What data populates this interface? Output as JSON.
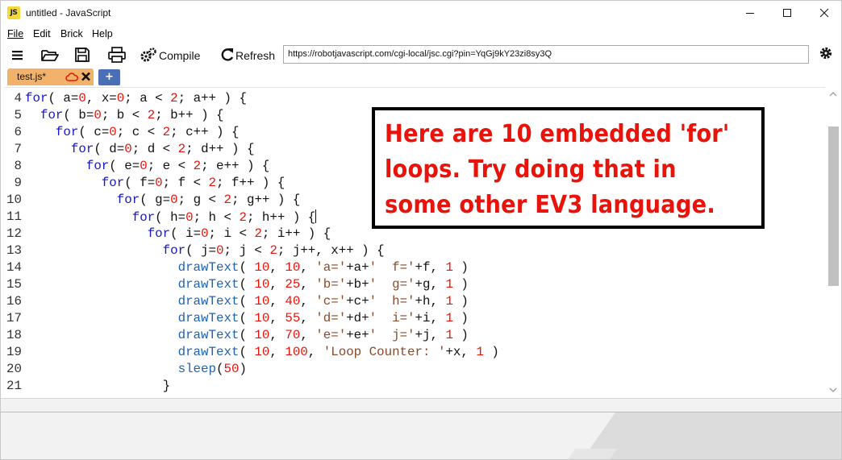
{
  "window": {
    "title": "untitled - JavaScript",
    "logo_text": "JS"
  },
  "menu": [
    "File",
    "Edit",
    "Brick",
    "Help"
  ],
  "toolbar": {
    "compile_label": "Compile",
    "refresh_label": "Refresh",
    "url": "https://robotjavascript.com/cgi-local/jsc.cgi?pin=YqGj9kY23zi8sy3Q"
  },
  "tabs": {
    "active_label": "test.js*",
    "add_label": "+"
  },
  "editor": {
    "line_numbers": [
      "4",
      "5",
      "6",
      "7",
      "8",
      "9",
      "10",
      "11",
      "12",
      "13",
      "14",
      "15",
      "16",
      "17",
      "18",
      "19",
      "20",
      "21"
    ]
  },
  "annotation": {
    "lines": [
      "Here are 10 embedded 'for'",
      "loops.  Try doing that in",
      "some other EV3 language."
    ]
  },
  "colors": {
    "keyword": "#1717c9",
    "function": "#1f62b0",
    "number": "#e8140c",
    "string": "#8a4a2a",
    "tab_active": "#f3b26a",
    "tab_add": "#4a6fb5",
    "annotation_text": "#e8140c"
  },
  "icons": [
    "app-logo-icon",
    "minimize-icon",
    "maximize-icon",
    "close-icon",
    "hamburger-menu-icon",
    "open-folder-icon",
    "save-icon",
    "print-icon",
    "gears-icon",
    "refresh-icon",
    "settings-gear-icon",
    "cloud-icon",
    "tab-close-icon"
  ]
}
